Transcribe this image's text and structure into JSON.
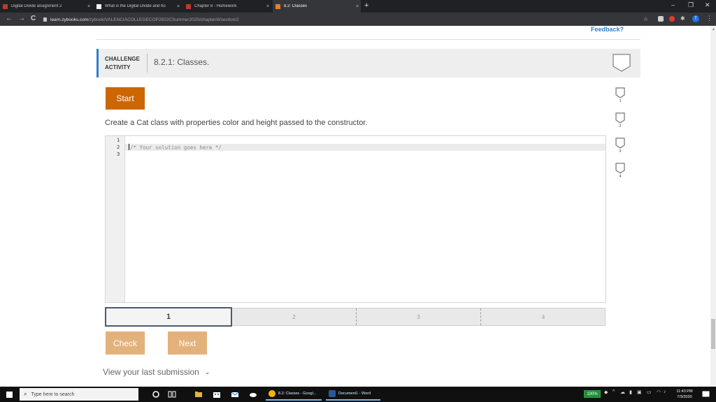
{
  "browser": {
    "tabs": [
      {
        "title": "Digital Divide assignment 2",
        "favicon_color": "#c0392b",
        "close": "×"
      },
      {
        "title": "What is the Digital Divide and ho",
        "favicon_color": "#f0f0f0",
        "close": "×"
      },
      {
        "title": "Chapter 8 - Homework",
        "favicon_color": "#c0392b",
        "close": "×"
      },
      {
        "title": "8.2: Classes",
        "favicon_color": "#e67e22",
        "close": "×"
      }
    ],
    "new_tab": "+",
    "window_controls": {
      "minimize": "–",
      "restore": "❐",
      "close": "✕"
    },
    "nav": {
      "back": "←",
      "forward": "→",
      "reload": "C"
    },
    "url_host": "learn.zybooks.com",
    "url_path": "/zybook/VALENCIACOLLEGECOP2822CSummer2020/chapter/8/section/2",
    "profile_initial": "T"
  },
  "page": {
    "feedback": "Feedback?",
    "activity_kind": "CHALLENGE ACTIVITY",
    "activity_title": "8.2.1: Classes.",
    "start_label": "Start",
    "prompt": "Create a Cat class with properties color and height passed to the constructor.",
    "editor": {
      "line_numbers": [
        "1",
        "2",
        "3"
      ],
      "code": "/* Your solution goes here */"
    },
    "levels": [
      {
        "label": "1",
        "current": true
      },
      {
        "label": "2",
        "current": false
      },
      {
        "label": "3",
        "current": false
      },
      {
        "label": "4",
        "current": false
      }
    ],
    "check_label": "Check",
    "next_label": "Next",
    "last_submission": "View your last submission",
    "side_levels": [
      "1",
      "2",
      "3",
      "4"
    ]
  },
  "colors": {
    "accent_blue": "#2d7fcf",
    "start_orange": "#cc6600",
    "disabled_orange": "#e3b27a"
  },
  "taskbar": {
    "search_placeholder": "Type here to search",
    "apps": [
      {
        "label": "8.2: Classes - Googl...",
        "icon": "chrome-icon"
      },
      {
        "label": "Document1 - Word",
        "icon": "word-icon"
      }
    ],
    "battery": "100%",
    "time": "11:43 PM",
    "date": "7/3/2020"
  }
}
